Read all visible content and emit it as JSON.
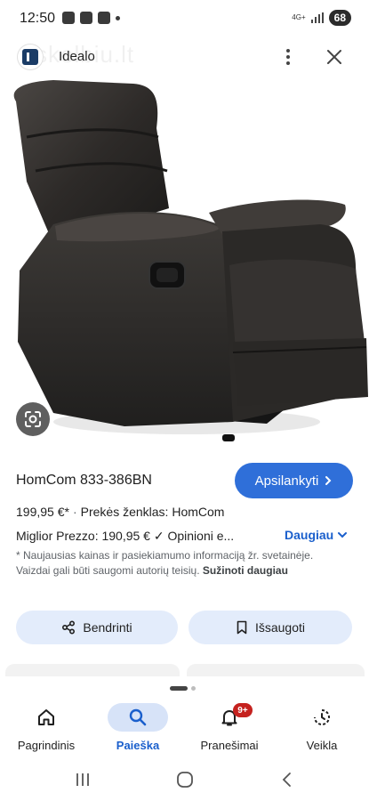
{
  "status_bar": {
    "time": "12:50",
    "network": "4G+",
    "battery": "68"
  },
  "header": {
    "site_name": "Idealo",
    "watermark": "skelbiu.lt"
  },
  "product": {
    "title": "HomCom 833-386BN",
    "price": "199,95 €*",
    "brand": "Prekės ženklas: HomCom",
    "meta": "Miglior Prezzo: 190,95 € ✓ Opinioni e...",
    "disclaimer_text": "* Naujausias kainas ir pasiekiamumo informaciją žr. svetainėje. Vaizdai gali būti saugomi autorių teisių.",
    "disclaimer_link": "Sužinoti daugiau"
  },
  "actions": {
    "visit_label": "Apsilankyti",
    "more_label": "Daugiau",
    "share_label": "Bendrinti",
    "save_label": "Išsaugoti"
  },
  "bottom_nav": {
    "items": [
      {
        "label": "Pagrindinis",
        "icon": "home-icon",
        "active": false
      },
      {
        "label": "Paieška",
        "icon": "search-icon",
        "active": true
      },
      {
        "label": "Pranešimai",
        "icon": "bell-icon",
        "active": false,
        "badge": "9+"
      },
      {
        "label": "Veikla",
        "icon": "activity-icon",
        "active": false
      }
    ]
  },
  "colors": {
    "accent": "#2f6fd9",
    "link": "#1a5fcc",
    "pill_bg": "#e3ecfb",
    "badge": "#c5221f",
    "chair": "#2a2725"
  }
}
